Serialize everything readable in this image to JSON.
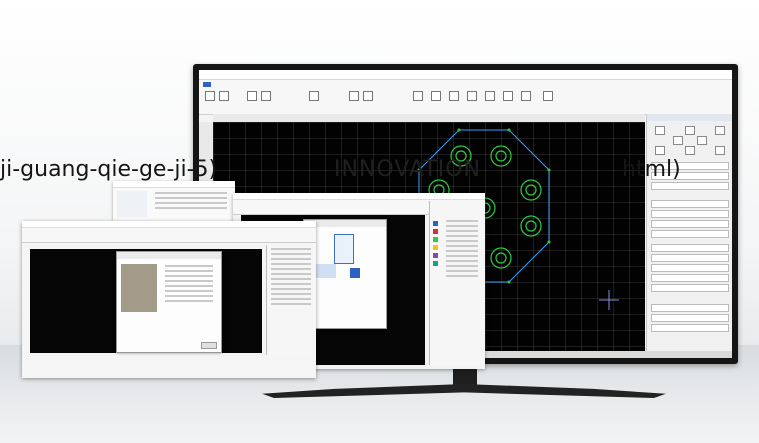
{
  "overlay_text": {
    "left": "ji-guang-qie-ge-ji-5)",
    "middle": "INNOVATION",
    "right": "html)"
  },
  "colors": {
    "canvas": "#020202",
    "shape_outline": "#3aa0ff",
    "shape_points": "#2ecc40",
    "accent_blue": "#2b62c4",
    "panel_red": "#c0392b"
  },
  "icons": [
    "crosshair-icon",
    "arrow-up-icon",
    "arrow-down-icon",
    "arrow-left-icon",
    "arrow-right-icon"
  ]
}
